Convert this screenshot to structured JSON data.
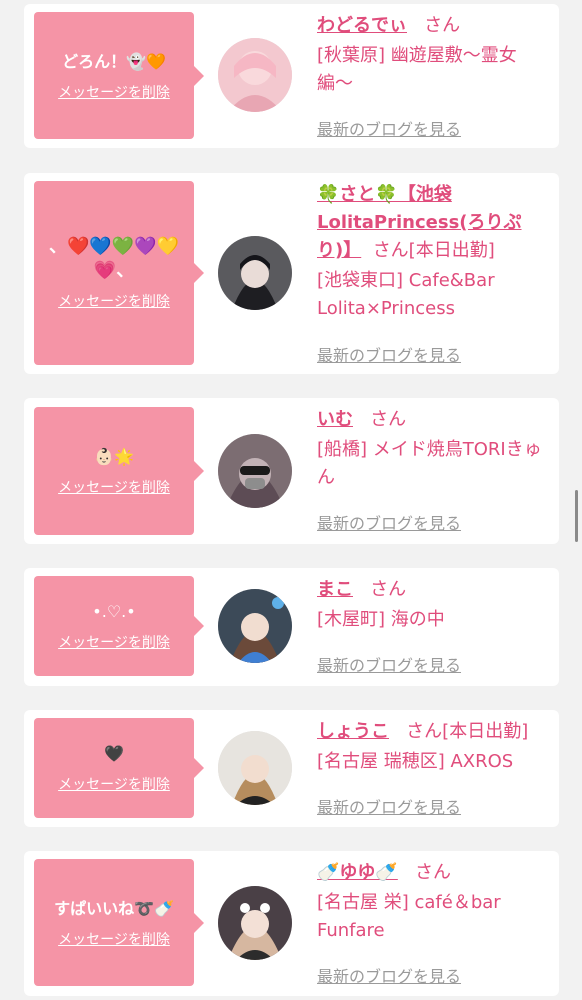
{
  "cards": [
    {
      "message": "どろん！👻🧡",
      "delete_label": "メッセージを削除",
      "name": "わどるでぃ",
      "suffix": "さん",
      "shop": "[秋葉原] 幽遊屋敷〜霊女編〜",
      "blog_label": "最新のブログを見る"
    },
    {
      "message": "、❤️💙💚💜💛💗、",
      "delete_label": "メッセージを削除",
      "name": "🍀さと🍀【池袋LolitaPrincess(ろりぷり)】",
      "suffix": "さん[本日出勤]",
      "shop": "[池袋東口] Cafe&Bar Lolita×Princess",
      "blog_label": "最新のブログを見る"
    },
    {
      "message": "👶🏻🌟",
      "delete_label": "メッセージを削除",
      "name": "いむ",
      "suffix": "さん",
      "shop": "[船橋] メイド焼鳥TORIきゅん",
      "blog_label": "最新のブログを見る"
    },
    {
      "message": "•.♡.•",
      "delete_label": "メッセージを削除",
      "name": "まこ",
      "suffix": "さん",
      "shop": "[木屋町] 海の中",
      "blog_label": "最新のブログを見る"
    },
    {
      "message": "🖤",
      "delete_label": "メッセージを削除",
      "name": "しょうこ",
      "suffix": "さん[本日出勤]",
      "shop": "[名古屋 瑞穂区] AXROS",
      "blog_label": "最新のブログを見る"
    },
    {
      "message": "すぱいいね➰🍼",
      "delete_label": "メッセージを削除",
      "name": "🍼ゆゆ🍼",
      "suffix": "さん",
      "shop": "[名古屋 栄] café＆bar Funfare",
      "blog_label": "最新のブログを見る"
    }
  ],
  "colors": {
    "accent": "#e04d7c",
    "bubble": "#f594a6",
    "link_gray": "#9a9a9a",
    "background": "#f2f2f2"
  }
}
